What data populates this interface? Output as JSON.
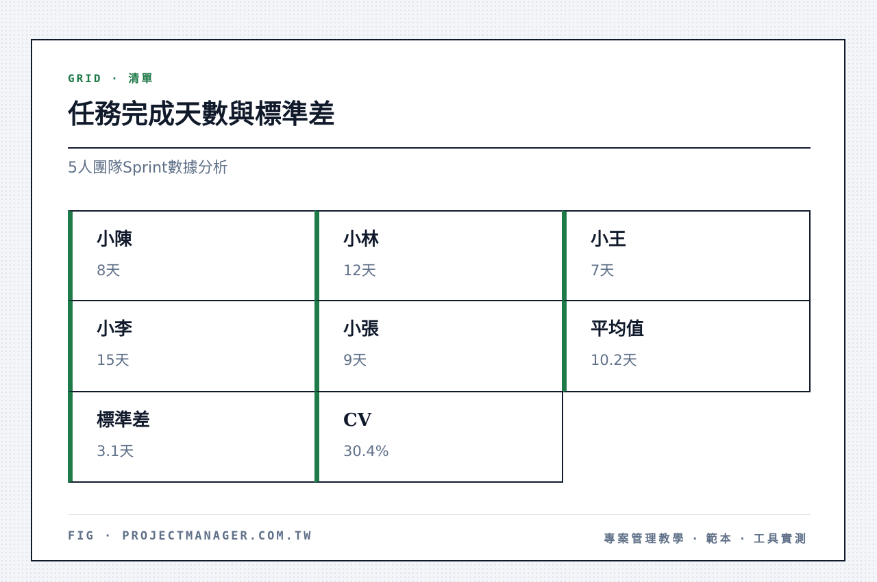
{
  "header": {
    "eyebrow": "GRID · 清單",
    "title": "任務完成天數與標準差",
    "subtitle": "5人團隊Sprint數據分析"
  },
  "items": [
    {
      "label": "小陳",
      "value": "8天"
    },
    {
      "label": "小林",
      "value": "12天"
    },
    {
      "label": "小王",
      "value": "7天"
    },
    {
      "label": "小李",
      "value": "15天"
    },
    {
      "label": "小張",
      "value": "9天"
    },
    {
      "label": "平均值",
      "value": "10.2天"
    },
    {
      "label": "標準差",
      "value": "3.1天"
    },
    {
      "label": "CV",
      "value": "30.4%"
    }
  ],
  "footer": {
    "left": "FIG · PROJECTMANAGER.COM.TW",
    "right": "專案管理教學 · 範本 · 工具實測"
  },
  "colors": {
    "accent": "#1f7a4a",
    "ink": "#111a2b",
    "muted": "#5f7088"
  }
}
